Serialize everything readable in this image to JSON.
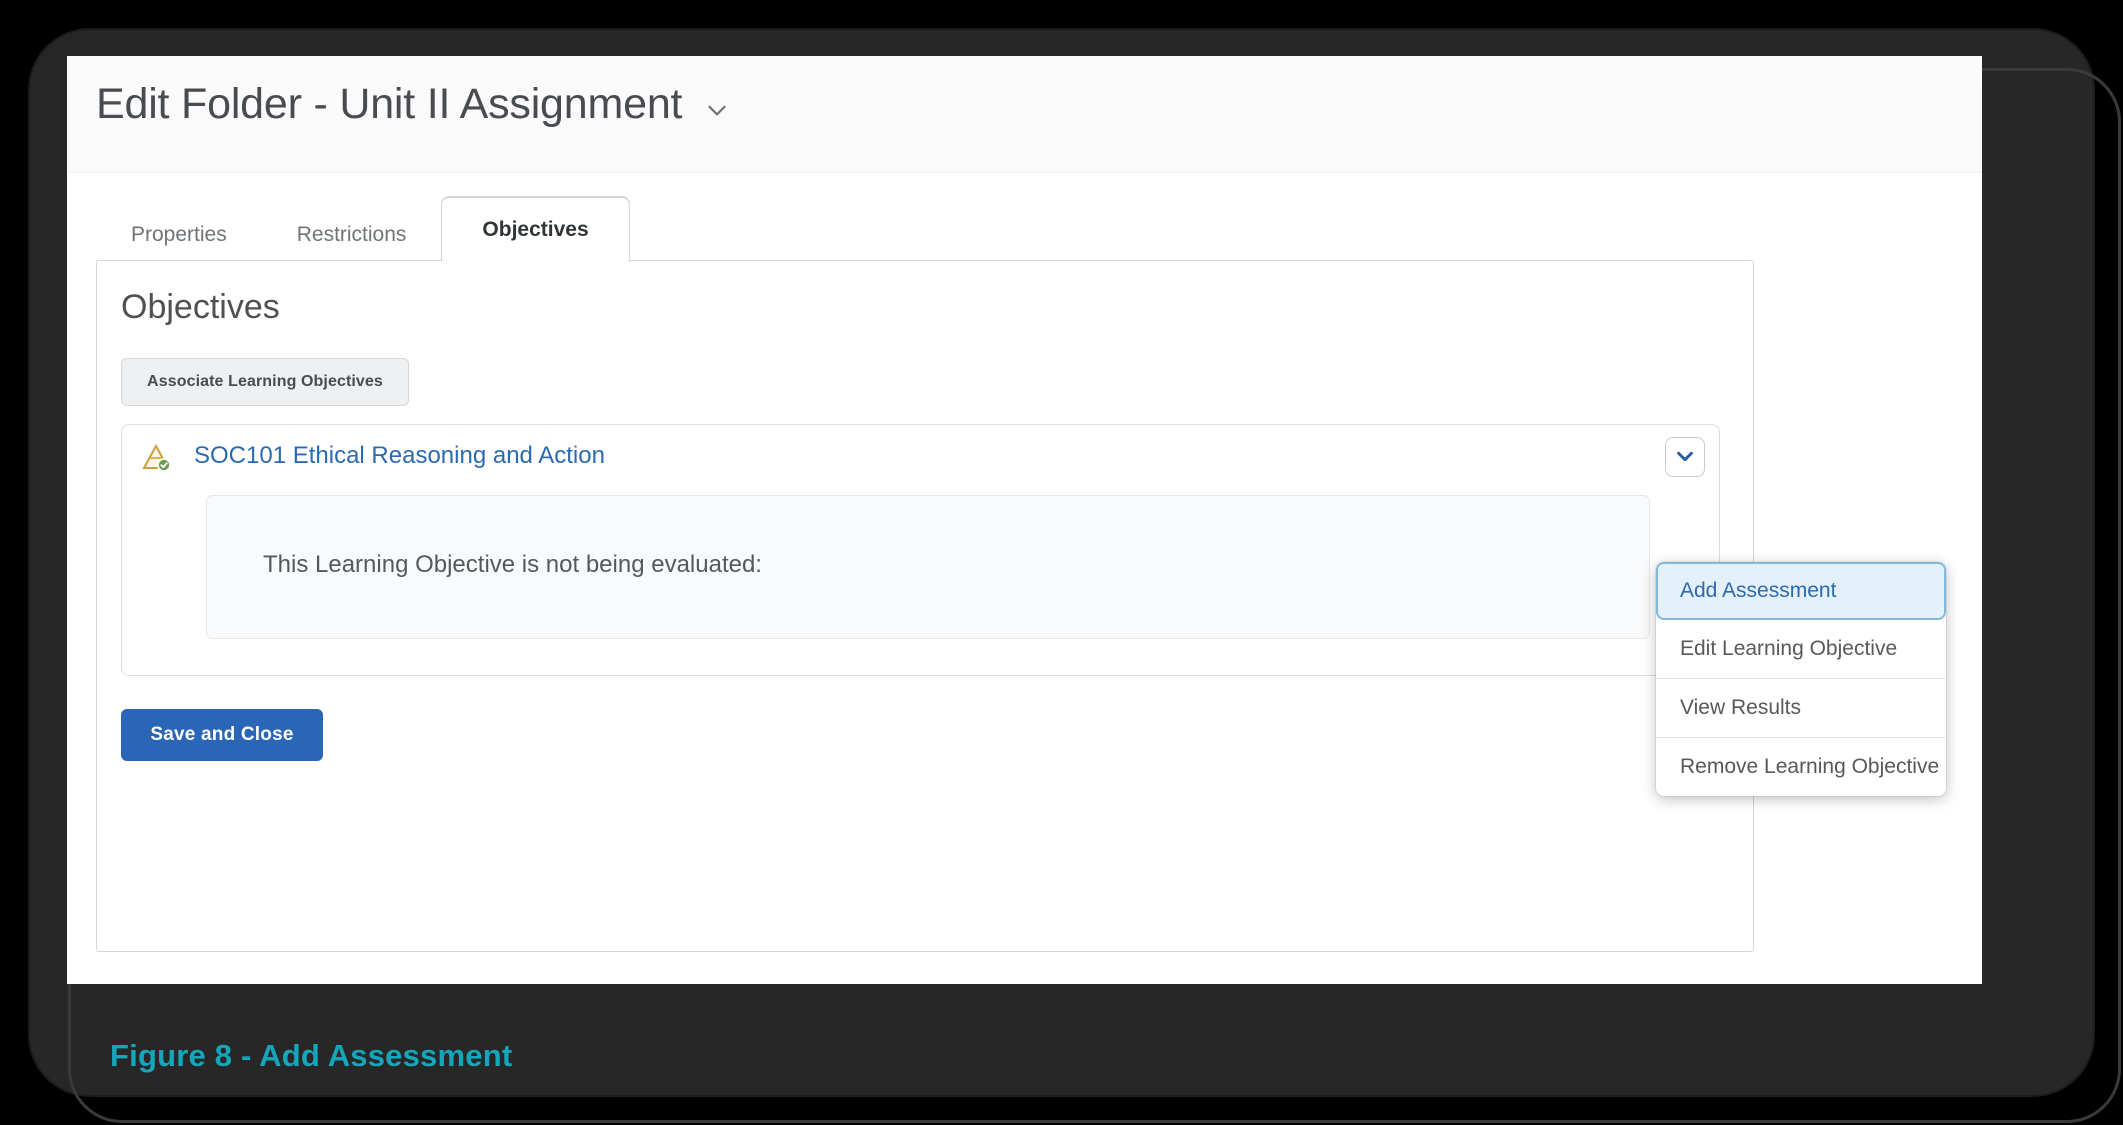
{
  "header": {
    "title": "Edit Folder - Unit II Assignment",
    "title_chevron_icon": "chevron-down-icon"
  },
  "tabs": [
    {
      "label": "Properties",
      "active": false
    },
    {
      "label": "Restrictions",
      "active": false
    },
    {
      "label": "Objectives",
      "active": true
    }
  ],
  "panel": {
    "heading": "Objectives",
    "associate_button_label": "Associate Learning Objectives",
    "objective": {
      "icon": "pyramid-objective-icon",
      "link_label": "SOC101 Ethical Reasoning and Action",
      "dropdown_toggle_icon": "chevron-down-icon",
      "evaluation_text": "This Learning Objective is not being evaluated:"
    },
    "save_button_label": "Save and Close"
  },
  "dropdown_menu": {
    "items": [
      {
        "label": "Add Assessment",
        "focused": true,
        "separator_after": false
      },
      {
        "label": "Edit Learning Objective",
        "focused": false,
        "separator_after": true
      },
      {
        "label": "View Results",
        "focused": false,
        "separator_after": true
      },
      {
        "label": "Remove Learning Objective",
        "focused": false,
        "separator_after": false
      }
    ]
  },
  "figure_caption": "Figure 8 - Add Assessment",
  "colors": {
    "accent_blue": "#2a66b5",
    "link_blue": "#2c6ab0",
    "menu_focus_bg": "#e4f0fa",
    "menu_focus_border": "#81b9dd",
    "caption_teal": "#14a7bb",
    "frame_dark": "#272727",
    "panel_border": "#d3d6d8"
  }
}
